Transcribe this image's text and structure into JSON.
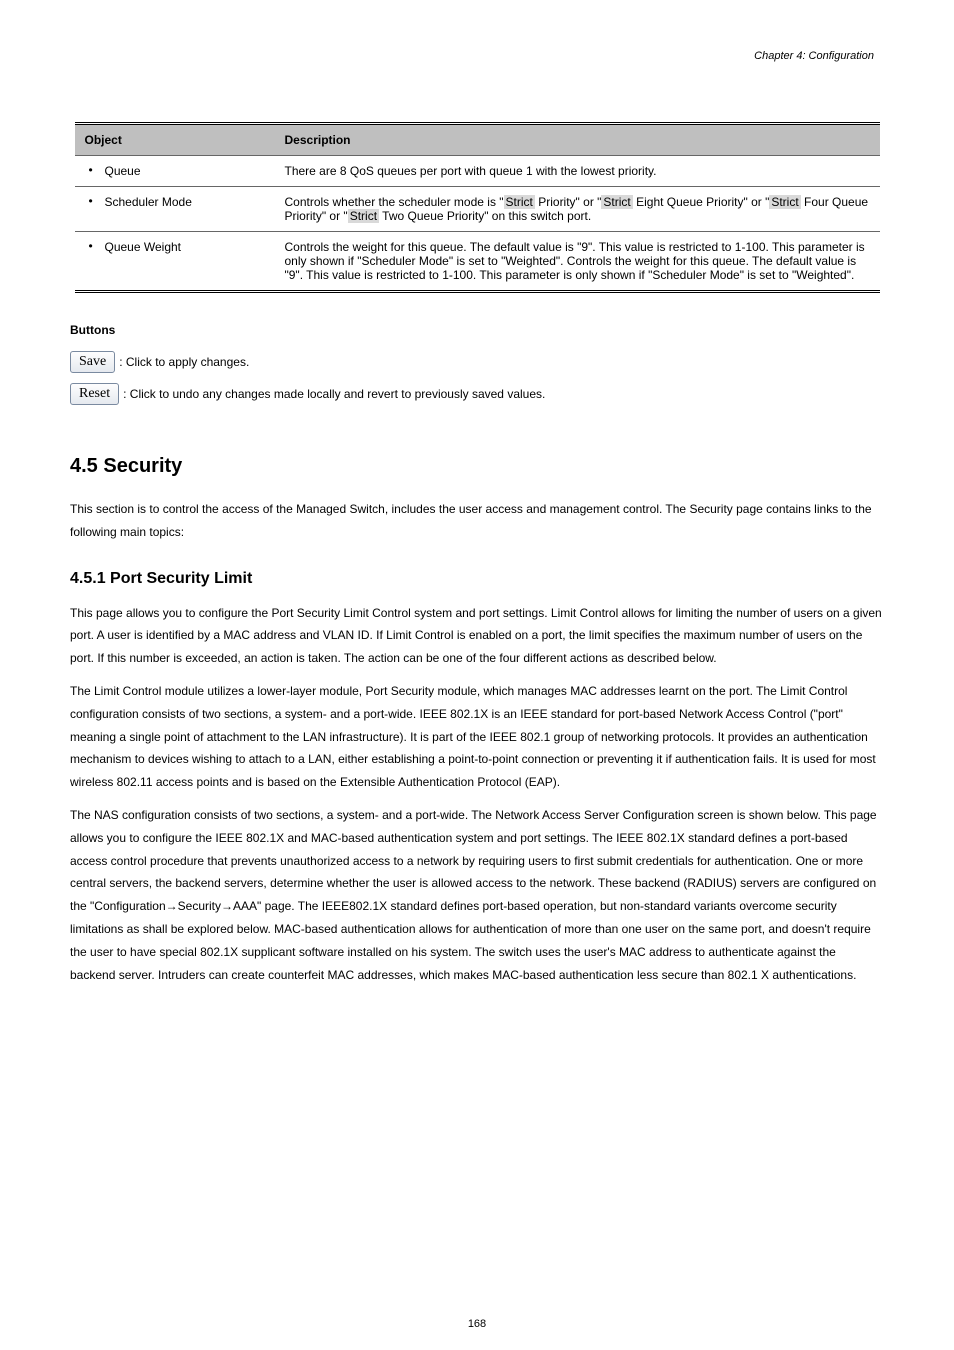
{
  "chapter_header": "Chapter 4: Configuration",
  "table": {
    "headers": [
      "Object",
      "Description"
    ],
    "rows": [
      {
        "object": "Queue",
        "description": "There are 8 QoS queues per port with queue 1 with the lowest priority."
      },
      {
        "object": "Scheduler Mode",
        "desc_line1": "Controls whether the scheduler mode is \"",
        "hl1": "Strict",
        "desc_line2": " Priority\" or \"",
        "hl2": "Strict",
        "desc_line3": " Eight Queue Priority\" or \"",
        "hl3": "Strict",
        "desc_line4": " Four Queue Priority\" or \"",
        "hl4": "Strict",
        "desc_line5": " Two Queue Priority\" on this switch port."
      },
      {
        "object": "Queue Weight",
        "description": "Controls the weight for this queue. The default value is \"9\". This value is restricted to 1-100. This parameter is only shown if \"Scheduler Mode\" is set to \"Weighted\". Controls the weight for this queue. The default value is \"9\". This value is restricted to 1-100. This parameter is only shown if \"Scheduler Mode\" is set to \"Weighted\"."
      }
    ]
  },
  "buttons": {
    "title": "Buttons",
    "save": {
      "label": "Save",
      "desc": ": Click to apply changes."
    },
    "reset": {
      "label": "Reset",
      "desc": ": Click to undo any changes made locally and revert to previously saved values."
    }
  },
  "section": {
    "h2": "4.5 Security",
    "p1": "This section is to control the access of the Managed Switch, includes the user access and management control. The Security page contains links to the following main topics:",
    "h3": "4.5.1 Port Security Limit",
    "p2_pre": "This page allows you to configure the Port Security Limit Control system and port settings. Limit Control allows for limiting the number of users on a given port. A user is identified by a MAC address and VLAN ID. If Limit Control is enabled on a port, the limit specifies the maximum number of users on the port. If this number is exceeded, an action is taken. The action can be one of the four different actions as described below.",
    "p2_mid": "The Limit Control module utilizes a lower-layer module, Port Security module, which manages MAC addresses learnt on the port. The Limit Control configuration consists of two sections, a system- and a port-wide. IEEE 802.1X is an IEEE standard for port-based Network Access Control (\"port\" meaning a single point of attachment to the LAN infrastructure). It is part of the IEEE 802.1 group of networking protocols. It provides an authentication mechanism to devices wishing to attach to a LAN, either establishing a point-to-point connection or preventing it if authentication fails. It is used for most wireless 802.11 access points and is based on the Extensible Authentication Protocol (EAP).",
    "p3_pre": "The NAS configuration consists of two sections, a system- and a port-wide. The Network Access Server Configuration screen is shown below. This page allows you to configure the IEEE 802.1X and MAC-based authentication system and port settings. The IEEE 802.1X standard defines a port-based access control procedure that prevents unauthorized access to a network by requiring users to first submit credentials for authentication. One or more central servers, the backend servers, determine whether the user is allowed access to the network. These backend (RADIUS) servers are configured on the ",
    "quoted_path": "\"Configuration→Security→AAA\" page. The IEEE802.1X standard defines port",
    "p3_post": "-based operation, but non-standard variants overcome security limitations as shall be explored below. MAC-based authentication allows for authentication of more than one user on the same port, and doesn't require the user to have special 802.1X supplicant software installed on his system. The switch uses the user's MAC address to authenticate against the backend server. Intruders can create counterfeit MAC addresses, which makes MAC-based authentication less secure than 802.1 X authentications."
  },
  "page_number": "168"
}
